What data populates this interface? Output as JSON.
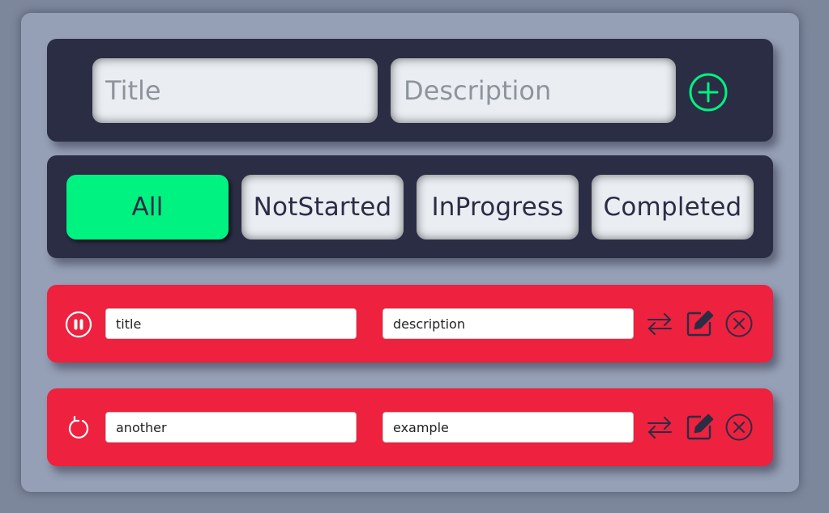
{
  "add_form": {
    "title_placeholder": "Title",
    "description_placeholder": "Description",
    "add_icon": "plus-circle-icon"
  },
  "filters": {
    "active": "All",
    "items": [
      {
        "label": "All"
      },
      {
        "label": "NotStarted"
      },
      {
        "label": "InProgress"
      },
      {
        "label": "Completed"
      }
    ]
  },
  "tasks": [
    {
      "title": "title",
      "description": "description",
      "status_icon": "pause-circle-icon",
      "actions": [
        "swap-icon",
        "edit-icon",
        "delete-icon"
      ]
    },
    {
      "title": "another",
      "description": "example",
      "status_icon": "restart-icon",
      "actions": [
        "swap-icon",
        "edit-icon",
        "delete-icon"
      ]
    }
  ],
  "colors": {
    "page_bg": "#7d879c",
    "container_bg": "#959fb5",
    "panel_bg": "#2b2d45",
    "accent_green": "#00f281",
    "task_red": "#ee213e",
    "input_bg": "#eaeef2"
  }
}
